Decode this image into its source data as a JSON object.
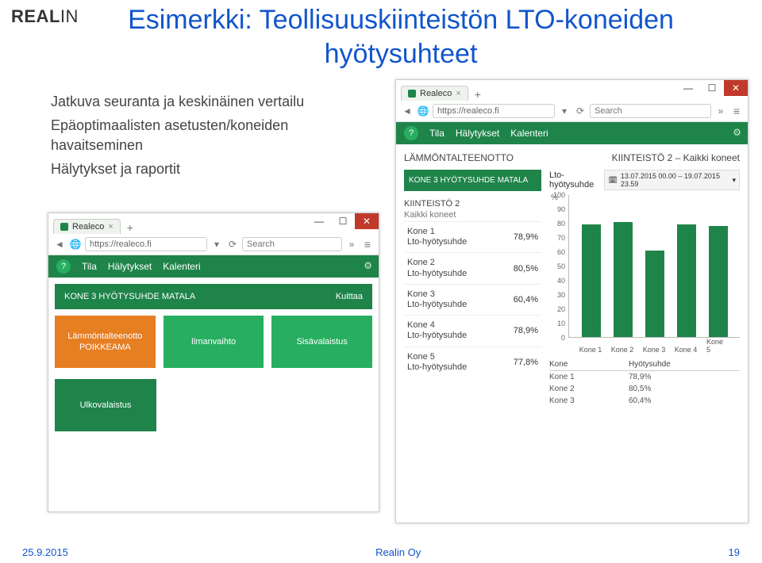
{
  "logo_a": "REAL",
  "logo_b": "IN",
  "title": "Esimerkki: Teollisuuskiinteistön LTO-koneiden hyötysuhteet",
  "bullets": [
    "Jatkuva seuranta ja keskinäinen vertailu",
    "Epäoptimaalisten asetusten/koneiden havaitseminen",
    "Hälytykset ja raportit"
  ],
  "browser": {
    "tab_label": "Realeco",
    "url": "https://realeco.fi",
    "search_ph": "Search",
    "nav": [
      "Tila",
      "Hälytykset",
      "Kalenteri"
    ]
  },
  "small": {
    "alert": "KONE 3 HYÖTYSUHDE MATALA",
    "ack": "Kuittaa",
    "tiles": [
      {
        "l1": "Lämmöntalteenotto",
        "l2": "POIKKEAMA"
      },
      {
        "l1": "Ilmanvaihto"
      },
      {
        "l1": "Sisävalaistus"
      }
    ],
    "tile2": "Ulkovalaistus"
  },
  "large": {
    "heading": "LÄMMÖNTALTEENOTTO",
    "breadcrumb": "KIINTEISTÖ 2 – Kaikki koneet",
    "pill": "KONE 3 HYÖTYSUHDE MATALA",
    "group_h": "KIINTEISTÖ 2",
    "group_s": "Kaikki koneet",
    "rows": [
      {
        "name": "Kone 1",
        "sub": "Lto-hyötysuhde",
        "val": "78,9%"
      },
      {
        "name": "Kone 2",
        "sub": "Lto-hyötysuhde",
        "val": "80,5%"
      },
      {
        "name": "Kone 3",
        "sub": "Lto-hyötysuhde",
        "val": "60,4%"
      },
      {
        "name": "Kone 4",
        "sub": "Lto-hyötysuhde",
        "val": "78,9%"
      },
      {
        "name": "Kone 5",
        "sub": "Lto-hyötysuhde",
        "val": "77,8%"
      }
    ],
    "chart_label": "Lto-hyötysuhde",
    "pct": "%",
    "date": "13.07.2015 00.00 – 19.07.2015 23.59",
    "table_h": [
      "Kone",
      "Hyötysuhde"
    ],
    "table": [
      [
        "Kone 1",
        "78,9%"
      ],
      [
        "Kone 2",
        "80,5%"
      ],
      [
        "Kone 3",
        "60,4%"
      ]
    ]
  },
  "chart_data": {
    "type": "bar",
    "ylabel": "%",
    "ylim": [
      0,
      100
    ],
    "yticks": [
      0,
      10,
      20,
      30,
      40,
      50,
      60,
      70,
      80,
      90,
      100
    ],
    "categories": [
      "Kone 1",
      "Kone 2",
      "Kone 3",
      "Kone 4",
      "Kone 5"
    ],
    "values": [
      78.9,
      80.5,
      60.4,
      78.9,
      77.8
    ]
  },
  "footer": {
    "date": "25.9.2015",
    "center": "Realin Oy",
    "page": "19"
  }
}
